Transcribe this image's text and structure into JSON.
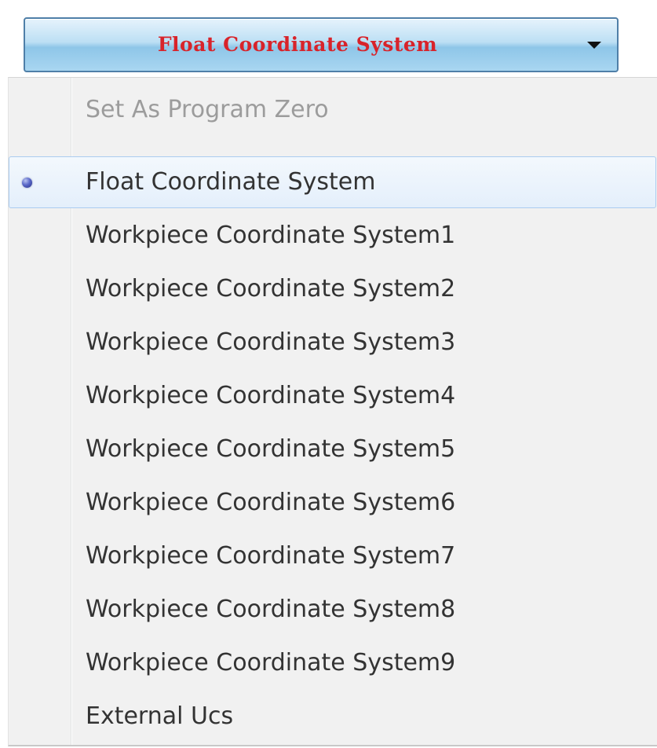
{
  "combo": {
    "selected_label": "Float Coordinate System"
  },
  "menu": {
    "header_item": "Set As Program Zero",
    "items": [
      {
        "label": "Float Coordinate System",
        "selected": true
      },
      {
        "label": "Workpiece Coordinate System1",
        "selected": false
      },
      {
        "label": "Workpiece Coordinate System2",
        "selected": false
      },
      {
        "label": "Workpiece Coordinate System3",
        "selected": false
      },
      {
        "label": "Workpiece Coordinate System4",
        "selected": false
      },
      {
        "label": "Workpiece Coordinate System5",
        "selected": false
      },
      {
        "label": "Workpiece Coordinate System6",
        "selected": false
      },
      {
        "label": "Workpiece Coordinate System7",
        "selected": false
      },
      {
        "label": "Workpiece Coordinate System8",
        "selected": false
      },
      {
        "label": "Workpiece Coordinate System9",
        "selected": false
      },
      {
        "label": "External Ucs",
        "selected": false
      }
    ]
  },
  "colors": {
    "combo_text": "#d8232a",
    "selected_highlight": "#e4effb",
    "radio_dot": "#3a44a8"
  },
  "icons": {
    "combo_arrow": "chevron-down-icon",
    "selected_marker": "radio-dot-icon"
  }
}
